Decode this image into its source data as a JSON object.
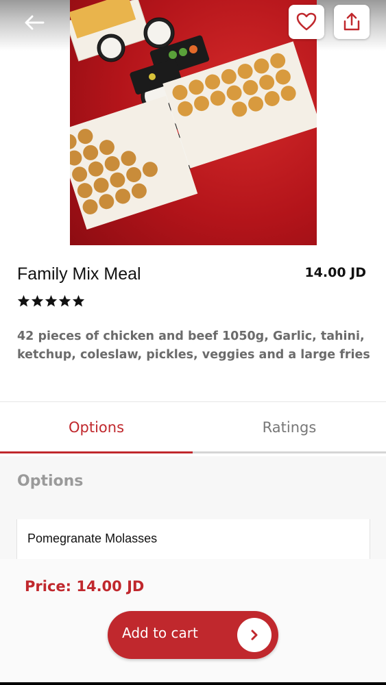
{
  "product": {
    "title": "Family Mix Meal",
    "price": "14.00 JD",
    "rating": 5,
    "description": "42 pieces of chicken and beef 1050g, Garlic, tahini, ketchup, coleslaw, pickles, veggies and a large fries"
  },
  "header": {
    "back_icon": "back-arrow-icon",
    "favorite_icon": "heart-icon",
    "share_icon": "share-icon"
  },
  "tabs": [
    {
      "label": "Options",
      "active": true
    },
    {
      "label": "Ratings",
      "active": false
    }
  ],
  "options": {
    "heading": "Options",
    "items": [
      {
        "label": "Pomegranate Molasses"
      }
    ]
  },
  "footer": {
    "price_label": "Price: 14.00 JD",
    "cart_label": "Add to cart"
  },
  "colors": {
    "accent": "#c0282d",
    "hero_background": "#b3141a"
  }
}
